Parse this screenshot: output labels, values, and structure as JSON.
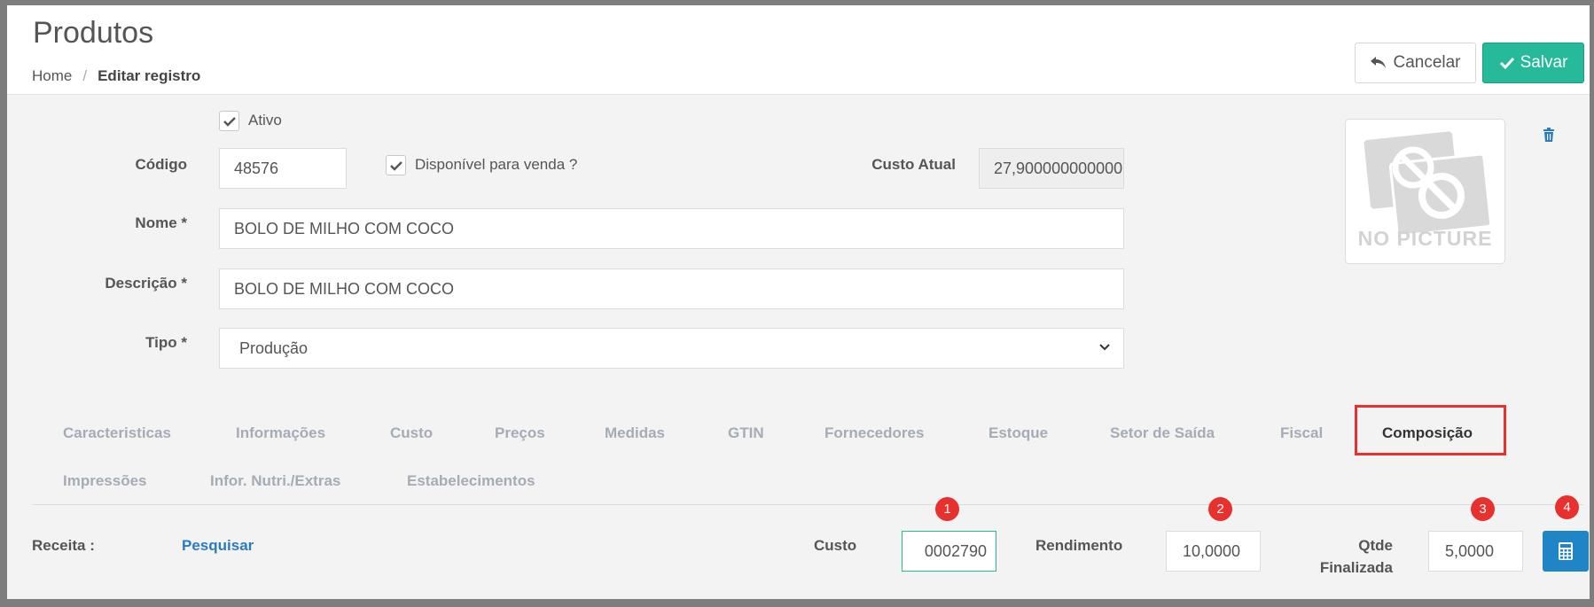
{
  "header": {
    "title": "Produtos",
    "breadcrumb": {
      "home": "Home",
      "separator": "/",
      "current": "Editar registro"
    },
    "cancel_label": "Cancelar",
    "save_label": "Salvar"
  },
  "form": {
    "ativo_label": "Ativo",
    "ativo_checked": true,
    "codigo_label": "Código",
    "codigo_value": "48576",
    "disponivel_label": "Disponível para venda ?",
    "disponivel_checked": true,
    "custo_atual_label": "Custo Atual",
    "custo_atual_value": "27,900000000000",
    "nome_label": "Nome *",
    "nome_value": "BOLO DE MILHO COM COCO",
    "descricao_label": "Descrição *",
    "descricao_value": "BOLO DE MILHO COM COCO",
    "tipo_label": "Tipo *",
    "tipo_value": "Produção",
    "picture_text": "NO PICTURE"
  },
  "tabs": [
    {
      "label": "Caracteristicas",
      "active": false
    },
    {
      "label": "Informações",
      "active": false
    },
    {
      "label": "Custo",
      "active": false
    },
    {
      "label": "Preços",
      "active": false
    },
    {
      "label": "Medidas",
      "active": false
    },
    {
      "label": "GTIN",
      "active": false
    },
    {
      "label": "Fornecedores",
      "active": false
    },
    {
      "label": "Estoque",
      "active": false
    },
    {
      "label": "Setor de Saída",
      "active": false
    },
    {
      "label": "Fiscal",
      "active": false
    },
    {
      "label": "Composição",
      "active": true
    },
    {
      "label": "Impressões",
      "active": false
    },
    {
      "label": "Infor. Nutri./Extras",
      "active": false
    },
    {
      "label": "Estabelecimentos",
      "active": false
    }
  ],
  "composicao": {
    "receita_label": "Receita :",
    "pesquisar_label": "Pesquisar",
    "custo_label": "Custo",
    "custo_value": "0002790",
    "rendimento_label": "Rendimento",
    "rendimento_value": "10,0000",
    "qtde_label_line1": "Qtde",
    "qtde_label_line2": "Finalizada",
    "qtde_value": "5,0000",
    "markers": [
      "1",
      "2",
      "3",
      "4"
    ]
  },
  "colors": {
    "accent_green": "#26b99a",
    "link_blue": "#2a7bbf",
    "calc_blue": "#1f85c6",
    "marker_red": "#e8302f"
  },
  "icons": {
    "cancel": "undo-arrow-icon",
    "save": "check-icon",
    "trash": "trash-icon",
    "calculator": "calculator-icon",
    "select": "chevron-down-icon"
  }
}
